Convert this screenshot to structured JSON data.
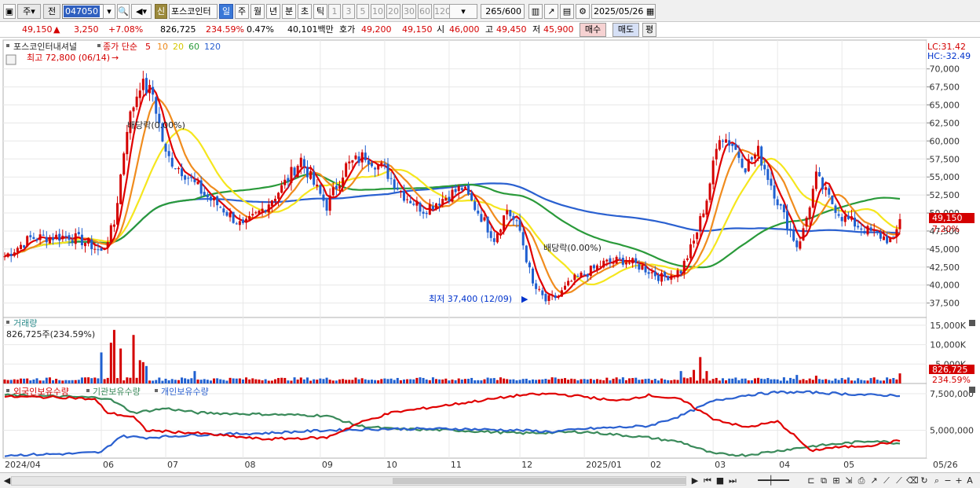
{
  "toolbar": {
    "period_mode": "주",
    "prev_label": "전",
    "stock_code": "047050",
    "sin_label": "신",
    "stock_name": "포스코인터",
    "period_buttons": [
      "일",
      "주",
      "월",
      "년",
      "분",
      "초",
      "틱"
    ],
    "active_period": "일",
    "interval_buttons": [
      "1",
      "3",
      "5",
      "10",
      "20",
      "30",
      "60",
      "120"
    ],
    "count_display": "265/600",
    "date": "2025/05/26"
  },
  "quote": {
    "price": "49,150",
    "change_arrow": "▲",
    "change": "3,250",
    "change_pct": "+7.08%",
    "volume": "826,725",
    "volume_ratio": "234.59%",
    "turnover": "0.47%",
    "amount": "40,101백만",
    "bid_label": "호가",
    "bid1": "49,200",
    "bid2": "49,150",
    "open_label": "시",
    "open": "46,000",
    "high_label": "고",
    "high": "49,450",
    "low_label": "저",
    "low": "45,900",
    "buy_button": "매수",
    "sell_button": "매도",
    "eval_button": "평"
  },
  "price_panel": {
    "stock_label": "포스코인터내셔널",
    "ma_label": "종가 단순",
    "ma_periods": [
      "5",
      "10",
      "20",
      "60",
      "120"
    ],
    "max_label": "최고 72,800 (06/14)",
    "min_label": "최저 37,400 (12/09)",
    "dividend1": "배당락(0.00%)",
    "dividend2": "배당락(0.00%)",
    "lc_label": "LC:31.42",
    "hc_label": "HC:-32.49",
    "last_price_tag": "49,150",
    "last_pct_tag": "7.20%"
  },
  "volume_panel": {
    "title": "거래량",
    "value_label": "826,725주(234.59%)",
    "last_tag": "826,725",
    "last_pct_tag": "234.59%"
  },
  "holding_panel": {
    "legends": [
      "외국인보유수량",
      "기관보유수량",
      "개인보유수량"
    ]
  },
  "colors": {
    "ma5": "#e00000",
    "ma10": "#f08c1e",
    "ma20": "#f5e61e",
    "ma60": "#2a9a3a",
    "ma120": "#2a60d0",
    "up": "#d40000",
    "down": "#1f5fd0",
    "foreign": "#e00000",
    "institution": "#3a8a5a",
    "individual": "#2a60d0"
  },
  "chart_data": {
    "type": "candlestick",
    "price_axis_ticks": [
      "70,000",
      "67,500",
      "65,000",
      "62,500",
      "60,000",
      "57,500",
      "55,000",
      "52,500",
      "50,000",
      "47,500",
      "45,000",
      "42,500",
      "40,000",
      "37,500"
    ],
    "volume_axis_ticks": [
      "15,000K",
      "10,000K",
      "5,000K"
    ],
    "holding_axis_ticks": [
      "7,500,000",
      "5,000,000"
    ],
    "x_labels": [
      "2024/04",
      "06",
      "07",
      "08",
      "09",
      "10",
      "11",
      "12",
      "2025/01",
      "02",
      "03",
      "04",
      "05",
      "05/26"
    ],
    "price_keypoints": [
      [
        0,
        44000
      ],
      [
        8,
        46500
      ],
      [
        20,
        46800
      ],
      [
        26,
        45800
      ],
      [
        30,
        44500
      ],
      [
        34,
        48500
      ],
      [
        38,
        62000
      ],
      [
        42,
        68000
      ],
      [
        46,
        66500
      ],
      [
        50,
        58000
      ],
      [
        56,
        55500
      ],
      [
        62,
        52500
      ],
      [
        68,
        50500
      ],
      [
        74,
        48000
      ],
      [
        80,
        50500
      ],
      [
        86,
        53500
      ],
      [
        92,
        57500
      ],
      [
        96,
        54000
      ],
      [
        100,
        51000
      ],
      [
        106,
        56500
      ],
      [
        112,
        58000
      ],
      [
        118,
        56000
      ],
      [
        124,
        52500
      ],
      [
        130,
        50500
      ],
      [
        136,
        52000
      ],
      [
        142,
        53500
      ],
      [
        148,
        49500
      ],
      [
        152,
        46500
      ],
      [
        156,
        50500
      ],
      [
        160,
        47500
      ],
      [
        164,
        40000
      ],
      [
        168,
        37800
      ],
      [
        172,
        38500
      ],
      [
        176,
        40500
      ],
      [
        180,
        41500
      ],
      [
        186,
        43000
      ],
      [
        192,
        43500
      ],
      [
        198,
        42500
      ],
      [
        204,
        41000
      ],
      [
        210,
        42000
      ],
      [
        214,
        46000
      ],
      [
        218,
        52000
      ],
      [
        222,
        61000
      ],
      [
        226,
        59500
      ],
      [
        230,
        56500
      ],
      [
        234,
        58500
      ],
      [
        238,
        54000
      ],
      [
        242,
        49500
      ],
      [
        246,
        45500
      ],
      [
        248,
        47500
      ],
      [
        252,
        55000
      ],
      [
        256,
        52000
      ],
      [
        260,
        49500
      ],
      [
        264,
        48500
      ],
      [
        268,
        47500
      ],
      [
        272,
        46800
      ],
      [
        276,
        46000
      ],
      [
        278,
        49150
      ]
    ],
    "volume_spikes": [
      [
        30,
        8000
      ],
      [
        33,
        10500
      ],
      [
        34,
        13800
      ],
      [
        36,
        9000
      ],
      [
        40,
        12500
      ],
      [
        42,
        6000
      ],
      [
        43,
        5500
      ],
      [
        44,
        4500
      ],
      [
        59,
        3200
      ],
      [
        210,
        3200
      ],
      [
        214,
        3500
      ],
      [
        216,
        6800
      ],
      [
        218,
        3200
      ],
      [
        246,
        2200
      ],
      [
        252,
        2000
      ],
      [
        278,
        2600
      ]
    ],
    "foreign_keypoints": [
      [
        0,
        7300000
      ],
      [
        20,
        7250000
      ],
      [
        28,
        7100000
      ],
      [
        32,
        6200000
      ],
      [
        40,
        5900000
      ],
      [
        44,
        5000000
      ],
      [
        60,
        4800000
      ],
      [
        80,
        4400000
      ],
      [
        100,
        4500000
      ],
      [
        110,
        5500000
      ],
      [
        120,
        6200000
      ],
      [
        140,
        6800000
      ],
      [
        160,
        7400000
      ],
      [
        170,
        7500000
      ],
      [
        180,
        7300000
      ],
      [
        190,
        7000000
      ],
      [
        200,
        7400000
      ],
      [
        210,
        7100000
      ],
      [
        220,
        5800000
      ],
      [
        230,
        5200000
      ],
      [
        240,
        5600000
      ],
      [
        246,
        4500000
      ],
      [
        250,
        3600000
      ],
      [
        256,
        3800000
      ],
      [
        264,
        3900000
      ],
      [
        270,
        4000000
      ],
      [
        278,
        4300000
      ]
    ],
    "institution_keypoints": [
      [
        0,
        7400000
      ],
      [
        20,
        7300000
      ],
      [
        32,
        7200000
      ],
      [
        40,
        6200000
      ],
      [
        50,
        6500000
      ],
      [
        60,
        6200000
      ],
      [
        80,
        6100000
      ],
      [
        100,
        6000000
      ],
      [
        110,
        5300000
      ],
      [
        120,
        5100000
      ],
      [
        140,
        5000000
      ],
      [
        160,
        4800000
      ],
      [
        180,
        4900000
      ],
      [
        200,
        4500000
      ],
      [
        210,
        4200000
      ],
      [
        220,
        3400000
      ],
      [
        230,
        3300000
      ],
      [
        240,
        3600000
      ],
      [
        250,
        3900000
      ],
      [
        260,
        4100000
      ],
      [
        270,
        4300000
      ],
      [
        278,
        4100000
      ]
    ],
    "individual_keypoints": [
      [
        0,
        3300000
      ],
      [
        20,
        3400000
      ],
      [
        30,
        3500000
      ],
      [
        36,
        4600000
      ],
      [
        44,
        4500000
      ],
      [
        60,
        4700000
      ],
      [
        80,
        4800000
      ],
      [
        100,
        5000000
      ],
      [
        120,
        5100000
      ],
      [
        140,
        5100000
      ],
      [
        160,
        5000000
      ],
      [
        170,
        4900000
      ],
      [
        180,
        5100000
      ],
      [
        200,
        5300000
      ],
      [
        210,
        6000000
      ],
      [
        220,
        7000000
      ],
      [
        230,
        7400000
      ],
      [
        240,
        7600000
      ],
      [
        250,
        7600000
      ],
      [
        260,
        7500000
      ],
      [
        270,
        7400000
      ],
      [
        278,
        7400000
      ]
    ]
  }
}
